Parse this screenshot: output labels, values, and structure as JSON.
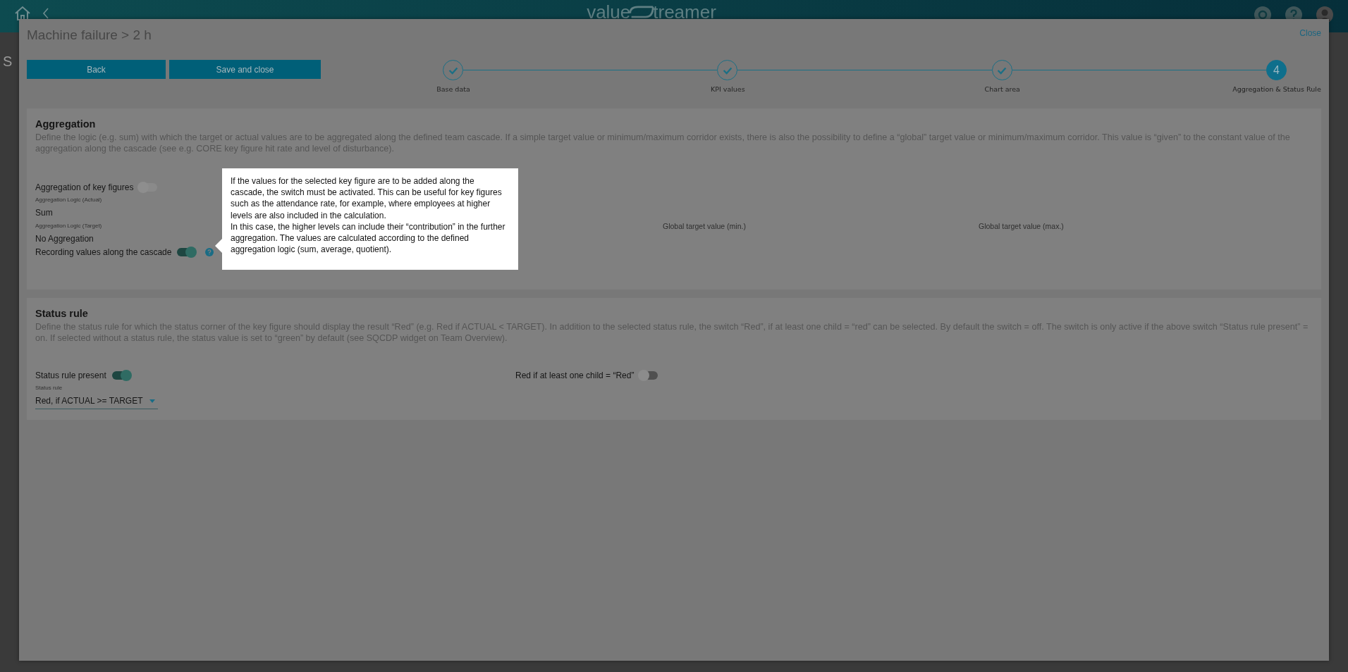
{
  "app_bar": {
    "logo_left": "value",
    "logo_right": "treamer"
  },
  "background": {
    "sidebar_heading": "S"
  },
  "dialog": {
    "title": "Machine failure > 2 h",
    "close": "Close",
    "buttons": [
      {
        "label": "Back"
      },
      {
        "label": "Save and close"
      }
    ],
    "steps": [
      {
        "label": "Base data",
        "done": true,
        "selected": false
      },
      {
        "label": "KPI values",
        "done": true,
        "selected": false
      },
      {
        "label": "Chart area",
        "done": true,
        "selected": false
      },
      {
        "label": "Aggregation & Status Rule",
        "number": "4",
        "done": false,
        "selected": true
      }
    ]
  },
  "aggregation": {
    "title": "Aggregation",
    "description": "Define the logic (e.g. sum) with which the target or actual values are to be aggregated along the defined team cascade. If a simple target value or minimum/maximum corridor exists, there is also the possibility to define a “global” target value or minimum/maximum corridor. This value is “given” to the constant value of the aggregation along the cascade (see e.g. CORE key figure hit rate and level of disturbance).",
    "key_figures_toggle": {
      "label": "Aggregation of key figures",
      "on": false,
      "disabled": true
    },
    "logic_actual": {
      "label": "Aggregation Logic (Actual)",
      "value": "Sum"
    },
    "logic_target": {
      "label": "Aggregation Logic (Target)",
      "value": "No Aggregation"
    },
    "cascade_toggle": {
      "label": "Recording values along the cascade",
      "on": true,
      "disabled": false
    },
    "global_min": {
      "label": "Global target value (min.)"
    },
    "global_max": {
      "label": "Global target value (max.)"
    },
    "tooltip": "If the values for the selected key figure are to be added along the cascade, the switch must be activated. This can be useful for key figures such as the attendance rate, for example, where employees at higher levels are also included in the calculation.\nIn this case, the higher levels can include their “contribution” in the further aggregation. The values are calculated according to the defined aggregation logic (sum, average, quotient)."
  },
  "status_rule": {
    "title": "Status rule",
    "description": "Define the status rule for which the status corner of the key figure should display the result “Red” (e.g. Red if ACTUAL < TARGET). In addition to the selected status rule, the switch “Red”, if at least one child = “red” can be selected. By default the switch = off. The switch is only active if the above switch “Status rule present” = on. If selected without a status rule, the status value is set to “green” by default (see SQCDP widget on Team Overview).",
    "present_toggle": {
      "label": "Status rule present",
      "on": true,
      "disabled": false
    },
    "rule_field": {
      "label": "Status rule",
      "value": "Red, if ACTUAL >= TARGET"
    },
    "red_child_toggle": {
      "label": "Red if at least one child = “Red”",
      "on": false,
      "disabled": false
    }
  }
}
